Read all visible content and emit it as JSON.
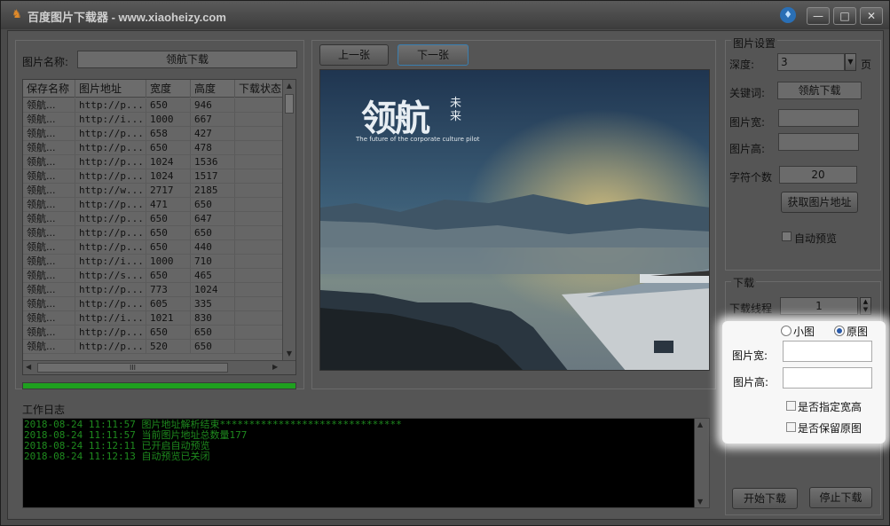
{
  "window": {
    "title": "百度图片下载器 - www.xiaoheizy.com",
    "minimize_glyph": "—",
    "maximize_glyph": "□",
    "close_glyph": "✕"
  },
  "left": {
    "name_label": "图片名称:",
    "name_value": "领航下载",
    "columns": [
      "保存名称",
      "图片地址",
      "宽度",
      "高度",
      "下载状态"
    ],
    "rows": [
      [
        "领航...",
        "http://p...",
        "650",
        "946",
        ""
      ],
      [
        "领航...",
        "http://i...",
        "1000",
        "667",
        ""
      ],
      [
        "领航...",
        "http://p...",
        "658",
        "427",
        ""
      ],
      [
        "领航...",
        "http://p...",
        "650",
        "478",
        ""
      ],
      [
        "领航...",
        "http://p...",
        "1024",
        "1536",
        ""
      ],
      [
        "领航...",
        "http://p...",
        "1024",
        "1517",
        ""
      ],
      [
        "领航...",
        "http://w...",
        "2717",
        "2185",
        ""
      ],
      [
        "领航...",
        "http://p...",
        "471",
        "650",
        ""
      ],
      [
        "领航...",
        "http://p...",
        "650",
        "647",
        ""
      ],
      [
        "领航...",
        "http://p...",
        "650",
        "650",
        ""
      ],
      [
        "领航...",
        "http://p...",
        "650",
        "440",
        ""
      ],
      [
        "领航...",
        "http://i...",
        "1000",
        "710",
        ""
      ],
      [
        "领航...",
        "http://s...",
        "650",
        "465",
        ""
      ],
      [
        "领航...",
        "http://p...",
        "773",
        "1024",
        ""
      ],
      [
        "领航...",
        "http://p...",
        "605",
        "335",
        ""
      ],
      [
        "领航...",
        "http://i...",
        "1021",
        "830",
        ""
      ],
      [
        "领航...",
        "http://p...",
        "650",
        "650",
        ""
      ],
      [
        "领航...",
        "http://p...",
        "520",
        "650",
        ""
      ]
    ],
    "hscroll_thumb_glyph": "III",
    "progress": 1.0
  },
  "nav": {
    "prev_label": "上一张",
    "next_label": "下一张"
  },
  "preview": {
    "brand_text": "领航",
    "brand_small": "未来",
    "tagline": "The future of the corporate culture pilot"
  },
  "log": {
    "title": "工作日志",
    "lines": [
      "2018-08-24 11:11:57 图片地址解析结束*******************************",
      "2018-08-24 11:11:57 当前图片地址总数量177",
      "2018-08-24 11:12:11 已开启自动预览",
      "2018-08-24 11:12:13 自动预览已关闭"
    ]
  },
  "settings": {
    "section_title": "图片设置",
    "depth_label": "深度:",
    "depth_value": "3",
    "depth_unit": "页",
    "keyword_label": "关键词:",
    "keyword_value": "领航下载",
    "width_label": "图片宽:",
    "width_value": "",
    "height_label": "图片高:",
    "height_value": "",
    "chars_label": "字符个数",
    "chars_value": "20",
    "fetch_button": "获取图片地址",
    "auto_preview_label": "自动预览"
  },
  "download": {
    "section_title": "下载",
    "threads_label": "下载线程",
    "threads_value": "1",
    "size_small_label": "小图",
    "size_original_label": "原图",
    "size_selected": "原图",
    "width_label": "图片宽:",
    "width_value": "",
    "height_label": "图片高:",
    "height_value": "",
    "specify_size_label": "是否指定宽高",
    "keep_original_label": "是否保留原图",
    "start_button": "开始下载",
    "stop_button": "停止下载"
  },
  "colors": {
    "log_text": "#1e8a1e",
    "progress_fill": "#1fa01f",
    "radio_dot": "#2a5aa8"
  }
}
